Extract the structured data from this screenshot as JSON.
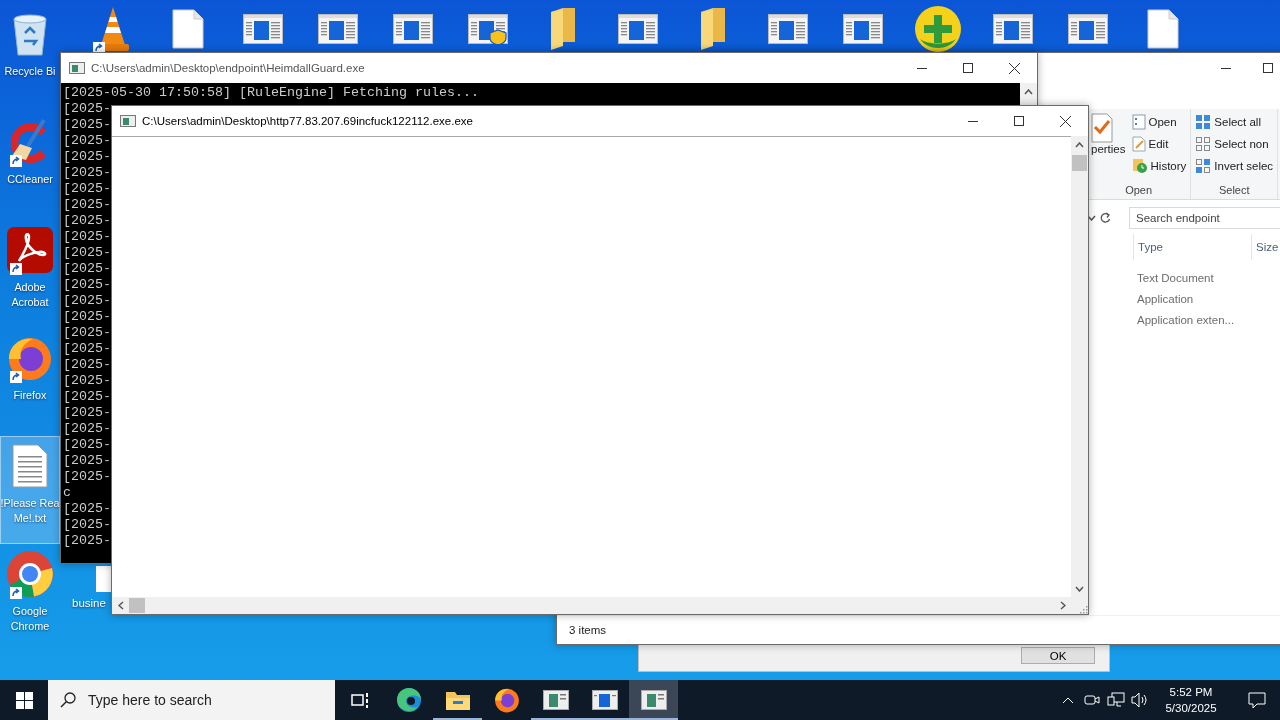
{
  "desktop": {
    "top_icons": [
      {
        "kind": "cone",
        "shortcut": true
      },
      {
        "kind": "file"
      },
      {
        "kind": "app"
      },
      {
        "kind": "app"
      },
      {
        "kind": "app"
      },
      {
        "kind": "app-shield"
      },
      {
        "kind": "folder"
      },
      {
        "kind": "app"
      },
      {
        "kind": "folder"
      },
      {
        "kind": "app"
      },
      {
        "kind": "app"
      },
      {
        "kind": "plus"
      },
      {
        "kind": "app"
      },
      {
        "kind": "app"
      },
      {
        "kind": "file"
      }
    ],
    "left_icons": [
      {
        "kind": "recycle-bin",
        "label_lines": [
          "Recycle Bi"
        ],
        "shortcut": false,
        "selected": false
      },
      {
        "kind": "cleaner",
        "label_lines": [
          "CCleaner"
        ],
        "shortcut": true,
        "selected": false
      },
      {
        "kind": "pdf",
        "label_lines": [
          "Adobe",
          "Acrobat"
        ],
        "shortcut": true,
        "selected": false
      },
      {
        "kind": "firefox",
        "label_lines": [
          "Firefox"
        ],
        "shortcut": true,
        "selected": false
      },
      {
        "kind": "text-file",
        "label_lines": [
          "!Please Rea",
          "Me!.txt"
        ],
        "shortcut": false,
        "selected": true
      },
      {
        "kind": "chrome",
        "label_lines": [
          "Google",
          "Chrome"
        ],
        "shortcut": true,
        "selected": false
      }
    ],
    "bottom_icon": {
      "label": "busine"
    }
  },
  "explorer": {
    "ribbon": {
      "properties_label": "perties",
      "groups": [
        {
          "label": "Open",
          "items": [
            {
              "kind": "open",
              "label": "Open"
            },
            {
              "kind": "edit",
              "label": "Edit"
            },
            {
              "kind": "history",
              "label": "History"
            }
          ]
        },
        {
          "label": "Select",
          "items": [
            {
              "kind": "select-all",
              "label": "Select all"
            },
            {
              "kind": "select-none",
              "label": "Select non"
            },
            {
              "kind": "invert",
              "label": "Invert selec"
            }
          ]
        }
      ]
    },
    "search": {
      "placeholder": "Search endpoint"
    },
    "columns": [
      "Type",
      "Size"
    ],
    "rows": [
      {
        "type": "Text Document"
      },
      {
        "type": "Application"
      },
      {
        "type": "Application exten..."
      }
    ],
    "status": "3 items"
  },
  "ok_window": {
    "button": "OK"
  },
  "console": {
    "title": "C:\\Users\\admin\\Desktop\\endpoint\\HeimdallGuard.exe",
    "lines": [
      "[2025-05-30 17:50:58] [RuleEngine] Fetching rules...",
      "[2025-",
      "[2025-",
      "[2025-",
      "[2025-",
      "[2025-",
      "[2025-",
      "[2025-",
      "[2025-",
      "[2025-",
      "[2025-",
      "[2025-",
      "[2025-",
      "[2025-",
      "[2025-",
      "[2025-",
      "[2025-",
      "[2025-",
      "[2025-",
      "[2025-",
      "[2025-",
      "[2025-",
      "[2025-",
      "[2025-",
      "[2025-",
      "c",
      "[2025-",
      "[2025-",
      "[2025-"
    ]
  },
  "dialog": {
    "title": "C:\\Users\\admin\\Desktop\\http77.83.207.69incfuck122112.exe.exe"
  },
  "taskbar": {
    "search_placeholder": "Type here to search",
    "apps": [
      {
        "kind": "task-view",
        "open": false,
        "selected": false
      },
      {
        "kind": "edge",
        "open": false,
        "selected": false
      },
      {
        "kind": "explorer",
        "open": true,
        "selected": false
      },
      {
        "kind": "firefox",
        "open": false,
        "selected": false
      },
      {
        "kind": "app",
        "open": true,
        "selected": false
      },
      {
        "kind": "app-blue",
        "open": true,
        "selected": false
      },
      {
        "kind": "app",
        "open": true,
        "selected": true
      }
    ],
    "time": "5:52 PM",
    "date": "5/30/2025"
  }
}
